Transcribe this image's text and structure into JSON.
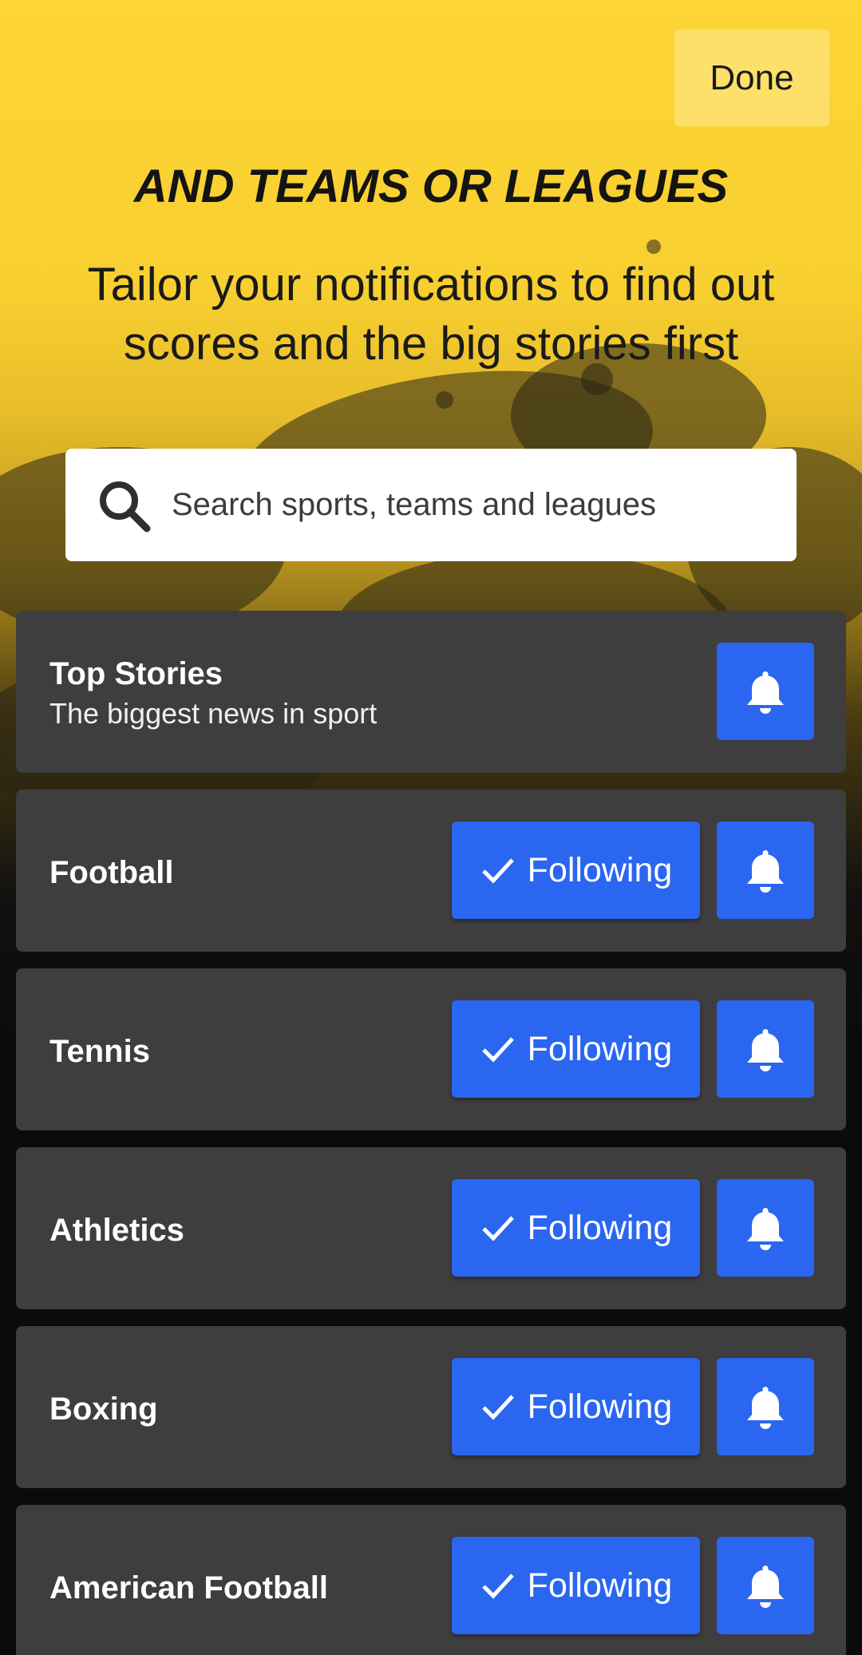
{
  "header": {
    "done_label": "Done",
    "heading": "AND TEAMS OR LEAGUES",
    "subheading": "Tailor your notifications to find out scores and the big stories first"
  },
  "search": {
    "placeholder": "Search sports, teams and leagues"
  },
  "top_stories": {
    "title": "Top Stories",
    "description": "The biggest news in sport",
    "icon": "bell-icon"
  },
  "sports": [
    {
      "name": "Football",
      "follow_label": "Following"
    },
    {
      "name": "Tennis",
      "follow_label": "Following"
    },
    {
      "name": "Athletics",
      "follow_label": "Following"
    },
    {
      "name": "Boxing",
      "follow_label": "Following"
    },
    {
      "name": "American Football",
      "follow_label": "Following"
    }
  ],
  "colors": {
    "accent": "#2a66f0",
    "card": "#3e3e3e",
    "background_top": "#fdd535"
  }
}
